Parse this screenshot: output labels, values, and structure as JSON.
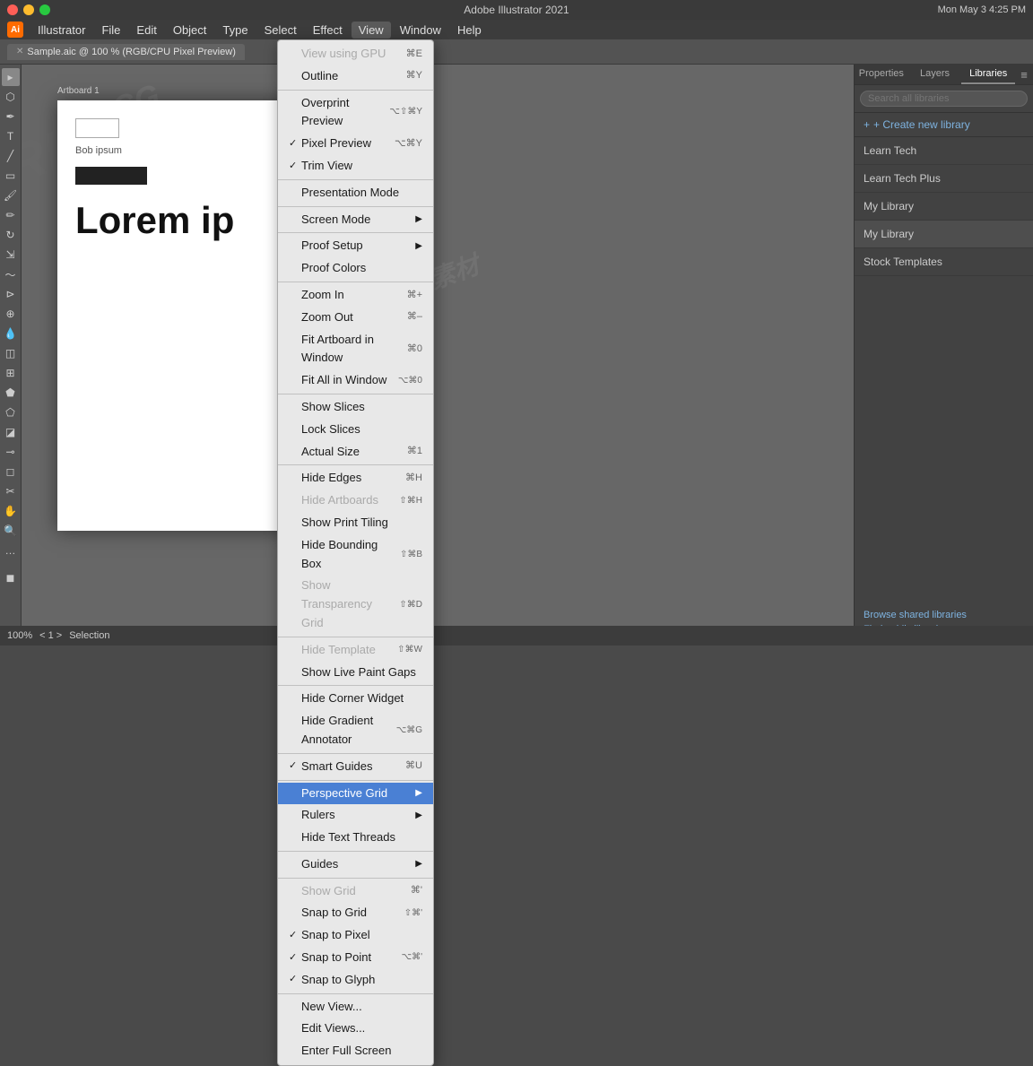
{
  "app": {
    "title": "Adobe Illustrator 2021",
    "document": "Sample.aic @ 100 % (RGB/CPU Pixel Preview)",
    "time": "Mon May 3  4:25 PM"
  },
  "menubar": {
    "items": [
      "Illustrator",
      "File",
      "Edit",
      "Object",
      "Type",
      "Select",
      "Effect",
      "View",
      "Window",
      "Help"
    ]
  },
  "view_menu": {
    "items": [
      {
        "id": "view-using-gpu",
        "check": "",
        "label": "View using GPU",
        "shortcut": "⌘E",
        "disabled": true,
        "has_arrow": false
      },
      {
        "id": "outline",
        "check": "",
        "label": "Outline",
        "shortcut": "⌘Y",
        "disabled": false,
        "has_arrow": false
      },
      {
        "id": "separator1",
        "type": "separator"
      },
      {
        "id": "overprint-preview",
        "check": "",
        "label": "Overprint Preview",
        "shortcut": "⌥⇧⌘Y",
        "disabled": false,
        "has_arrow": false
      },
      {
        "id": "pixel-preview",
        "check": "✓",
        "label": "Pixel Preview",
        "shortcut": "⌥⌘Y",
        "disabled": false,
        "has_arrow": false
      },
      {
        "id": "trim-view",
        "check": "✓",
        "label": "Trim View",
        "shortcut": "",
        "disabled": false,
        "has_arrow": false
      },
      {
        "id": "separator2",
        "type": "separator"
      },
      {
        "id": "presentation-mode",
        "check": "",
        "label": "Presentation Mode",
        "shortcut": "",
        "disabled": false,
        "has_arrow": false
      },
      {
        "id": "separator3",
        "type": "separator"
      },
      {
        "id": "screen-mode",
        "check": "",
        "label": "Screen Mode",
        "shortcut": "",
        "disabled": false,
        "has_arrow": true
      },
      {
        "id": "separator4",
        "type": "separator"
      },
      {
        "id": "proof-setup",
        "check": "",
        "label": "Proof Setup",
        "shortcut": "",
        "disabled": false,
        "has_arrow": true
      },
      {
        "id": "proof-colors",
        "check": "",
        "label": "Proof Colors",
        "shortcut": "",
        "disabled": false,
        "has_arrow": false
      },
      {
        "id": "separator5",
        "type": "separator"
      },
      {
        "id": "zoom-in",
        "check": "",
        "label": "Zoom In",
        "shortcut": "⌘+",
        "disabled": false,
        "has_arrow": false
      },
      {
        "id": "zoom-out",
        "check": "",
        "label": "Zoom Out",
        "shortcut": "⌘–",
        "disabled": false,
        "has_arrow": false
      },
      {
        "id": "fit-artboard",
        "check": "",
        "label": "Fit Artboard in Window",
        "shortcut": "⌘0",
        "disabled": false,
        "has_arrow": false
      },
      {
        "id": "fit-all",
        "check": "",
        "label": "Fit All in Window",
        "shortcut": "⌥⌘0",
        "disabled": false,
        "has_arrow": false
      },
      {
        "id": "separator6",
        "type": "separator"
      },
      {
        "id": "show-slices",
        "check": "",
        "label": "Show Slices",
        "shortcut": "",
        "disabled": false,
        "has_arrow": false
      },
      {
        "id": "lock-slices",
        "check": "",
        "label": "Lock Slices",
        "shortcut": "",
        "disabled": false,
        "has_arrow": false
      },
      {
        "id": "actual-size",
        "check": "",
        "label": "Actual Size",
        "shortcut": "⌘1",
        "disabled": false,
        "has_arrow": false
      },
      {
        "id": "separator7",
        "type": "separator"
      },
      {
        "id": "hide-edges",
        "check": "",
        "label": "Hide Edges",
        "shortcut": "⌘H",
        "disabled": false,
        "has_arrow": false
      },
      {
        "id": "hide-artboards",
        "check": "",
        "label": "Hide Artboards",
        "shortcut": "⇧⌘H",
        "disabled": true,
        "has_arrow": false
      },
      {
        "id": "show-print-tiling",
        "check": "",
        "label": "Show Print Tiling",
        "shortcut": "",
        "disabled": false,
        "has_arrow": false
      },
      {
        "id": "hide-bounding-box",
        "check": "",
        "label": "Hide Bounding Box",
        "shortcut": "⇧⌘B",
        "disabled": false,
        "has_arrow": false
      },
      {
        "id": "show-transparency-grid",
        "check": "",
        "label": "Show Transparency Grid",
        "shortcut": "⇧⌘D",
        "disabled": true,
        "has_arrow": false
      },
      {
        "id": "separator8",
        "type": "separator"
      },
      {
        "id": "hide-template",
        "check": "",
        "label": "Hide Template",
        "shortcut": "⇧⌘W",
        "disabled": true,
        "has_arrow": false
      },
      {
        "id": "show-live-paint-gaps",
        "check": "",
        "label": "Show Live Paint Gaps",
        "shortcut": "",
        "disabled": false,
        "has_arrow": false
      },
      {
        "id": "separator9",
        "type": "separator"
      },
      {
        "id": "hide-corner-widget",
        "check": "",
        "label": "Hide Corner Widget",
        "shortcut": "",
        "disabled": false,
        "has_arrow": false
      },
      {
        "id": "hide-gradient-annotator",
        "check": "",
        "label": "Hide Gradient Annotator",
        "shortcut": "⌥⌘G",
        "disabled": false,
        "has_arrow": false
      },
      {
        "id": "separator10",
        "type": "separator"
      },
      {
        "id": "smart-guides",
        "check": "✓",
        "label": "Smart Guides",
        "shortcut": "⌘U",
        "disabled": false,
        "has_arrow": false
      },
      {
        "id": "separator11",
        "type": "separator"
      },
      {
        "id": "perspective-grid",
        "check": "",
        "label": "Perspective Grid",
        "shortcut": "",
        "disabled": false,
        "has_arrow": true,
        "highlighted": true
      },
      {
        "id": "rulers",
        "check": "",
        "label": "Rulers",
        "shortcut": "",
        "disabled": false,
        "has_arrow": true
      },
      {
        "id": "hide-text-threads",
        "check": "",
        "label": "Hide Text Threads",
        "shortcut": "",
        "disabled": false,
        "has_arrow": false
      },
      {
        "id": "separator12",
        "type": "separator"
      },
      {
        "id": "guides",
        "check": "",
        "label": "Guides",
        "shortcut": "",
        "disabled": false,
        "has_arrow": true
      },
      {
        "id": "separator13",
        "type": "separator"
      },
      {
        "id": "show-grid",
        "check": "",
        "label": "Show Grid",
        "shortcut": "⌘'",
        "disabled": true,
        "has_arrow": false
      },
      {
        "id": "snap-to-grid",
        "check": "",
        "label": "Snap to Grid",
        "shortcut": "⇧⌘'",
        "disabled": false,
        "has_arrow": false
      },
      {
        "id": "snap-to-pixel",
        "check": "✓",
        "label": "Snap to Pixel",
        "shortcut": "",
        "disabled": false,
        "has_arrow": false
      },
      {
        "id": "snap-to-point",
        "check": "✓",
        "label": "Snap to Point",
        "shortcut": "⌥⌘'",
        "disabled": false,
        "has_arrow": false
      },
      {
        "id": "snap-to-glyph",
        "check": "✓",
        "label": "Snap to Glyph",
        "shortcut": "",
        "disabled": false,
        "has_arrow": false
      },
      {
        "id": "separator14",
        "type": "separator"
      },
      {
        "id": "new-view",
        "check": "",
        "label": "New View...",
        "shortcut": "",
        "disabled": false,
        "has_arrow": false
      },
      {
        "id": "edit-views",
        "check": "",
        "label": "Edit Views...",
        "shortcut": "",
        "disabled": false,
        "has_arrow": false
      },
      {
        "id": "enter-full-screen",
        "check": "",
        "label": "Enter Full Screen",
        "shortcut": "",
        "disabled": false,
        "has_arrow": false
      }
    ]
  },
  "panel": {
    "tabs": [
      "Properties",
      "Layers",
      "Libraries"
    ],
    "active_tab": "Libraries",
    "search_placeholder": "Search all libraries",
    "create_btn": "+ Create new library",
    "libraries": [
      "Learn Tech",
      "Learn Tech Plus",
      "My Library",
      "My Library",
      "Stock Templates"
    ],
    "links": [
      "Browse shared libraries",
      "Find public libraries"
    ]
  },
  "canvas": {
    "artboard_label": "Bob ipsum",
    "text_box_value": "",
    "lorem_text": "Lorem ip",
    "black_rect": true
  },
  "statusbar": {
    "zoom": "100%",
    "artboard_nav": "< 1 >",
    "tool": "Selection"
  }
}
